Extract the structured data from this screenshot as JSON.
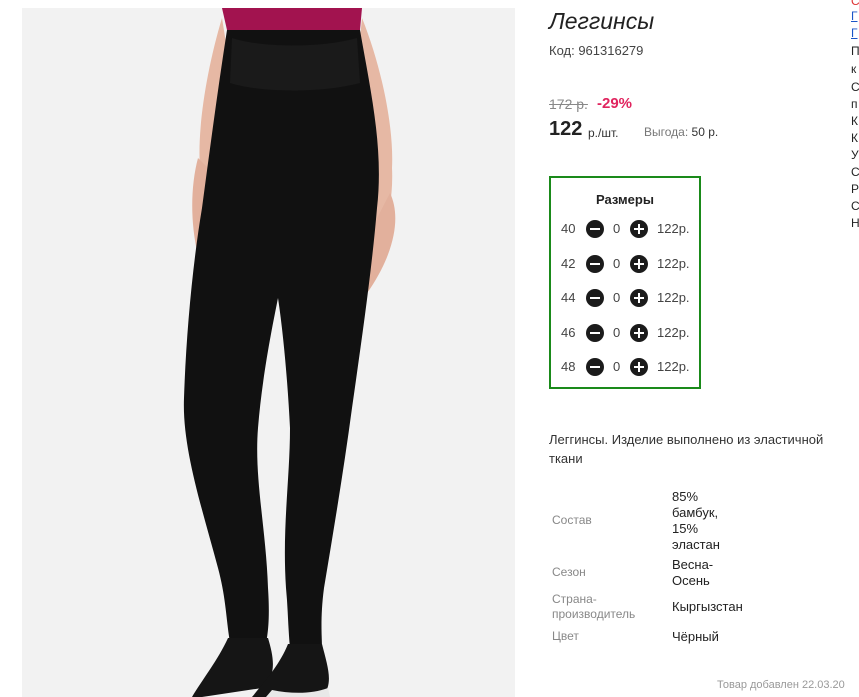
{
  "product": {
    "title": "Леггинсы",
    "code": "Код: 961316279",
    "old_price": "172 р.",
    "discount": "-29%",
    "price": "122",
    "price_unit": "р./шт.",
    "saving_label": "Выгода:",
    "saving_value": "50 р."
  },
  "sizes": {
    "title": "Размеры",
    "rows": [
      {
        "size": "40",
        "qty": "0",
        "price": "122р."
      },
      {
        "size": "42",
        "qty": "0",
        "price": "122р."
      },
      {
        "size": "44",
        "qty": "0",
        "price": "122р."
      },
      {
        "size": "46",
        "qty": "0",
        "price": "122р."
      },
      {
        "size": "48",
        "qty": "0",
        "price": "122р."
      }
    ]
  },
  "description": "Леггинсы. Изделие выполнено из эластичной ткани",
  "specs": {
    "composition_label": "Состав",
    "composition_value": "85% бамбук, 15% эластан",
    "season_label": "Сезон",
    "season_value": "Весна-Осень",
    "country_label": "Страна-производитель",
    "country_value": "Кыргызстан",
    "color_label": "Цвет",
    "color_value": "Чёрный"
  },
  "added": "Товар добавлен 22.03.20",
  "edge_letters": [
    "С",
    "Г",
    "Г",
    "П",
    "к",
    "С",
    "п",
    "К",
    "К",
    "У",
    "С",
    "Р",
    "С",
    "Н"
  ],
  "colors": {
    "sizes_border": "#1a8a1a",
    "discount": "#e0245e"
  }
}
